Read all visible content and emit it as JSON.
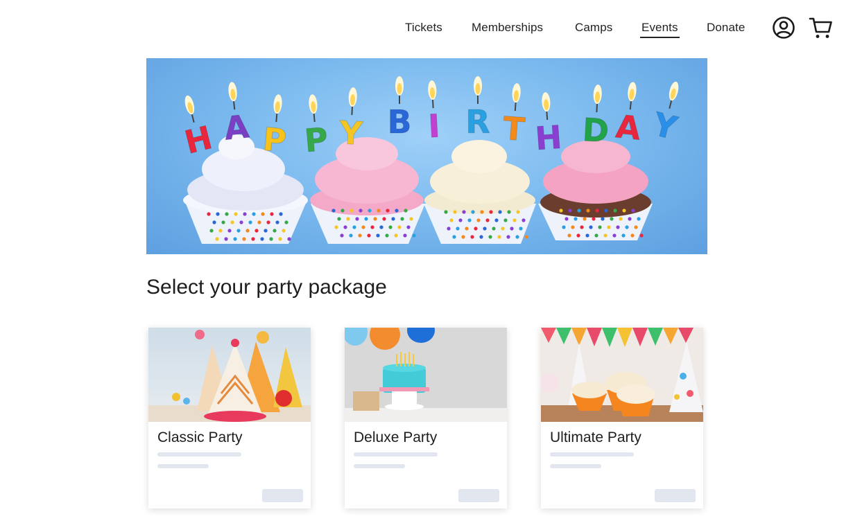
{
  "nav": {
    "links": [
      {
        "label": "Tickets"
      },
      {
        "label": "Memberships"
      },
      {
        "label": "Camps"
      },
      {
        "label": "Events",
        "active": true
      },
      {
        "label": "Donate"
      }
    ],
    "icons": [
      "account-icon",
      "cart-icon"
    ]
  },
  "hero": {
    "candle_letters": [
      "H",
      "A",
      "P",
      "P",
      "Y",
      "B",
      "I",
      "R",
      "T",
      "H",
      "D",
      "A",
      "Y"
    ],
    "candle_colors": [
      "#e8273f",
      "#7b3fc4",
      "#f6c21b",
      "#36a84a",
      "#f4c625",
      "#2a67d6",
      "#c13fd1",
      "#2aa0e0",
      "#f48a1c",
      "#8a3fd0",
      "#22a34a",
      "#e8273f",
      "#2a8fe8"
    ]
  },
  "main": {
    "heading": "Select your party package",
    "packages": [
      {
        "title": "Classic Party"
      },
      {
        "title": "Deluxe Party"
      },
      {
        "title": "Ultimate Party"
      }
    ]
  },
  "colors": {
    "text": "#1e1e1e",
    "placeholder": "#e2e6ef",
    "hero_bg": "#7ab9ee"
  }
}
